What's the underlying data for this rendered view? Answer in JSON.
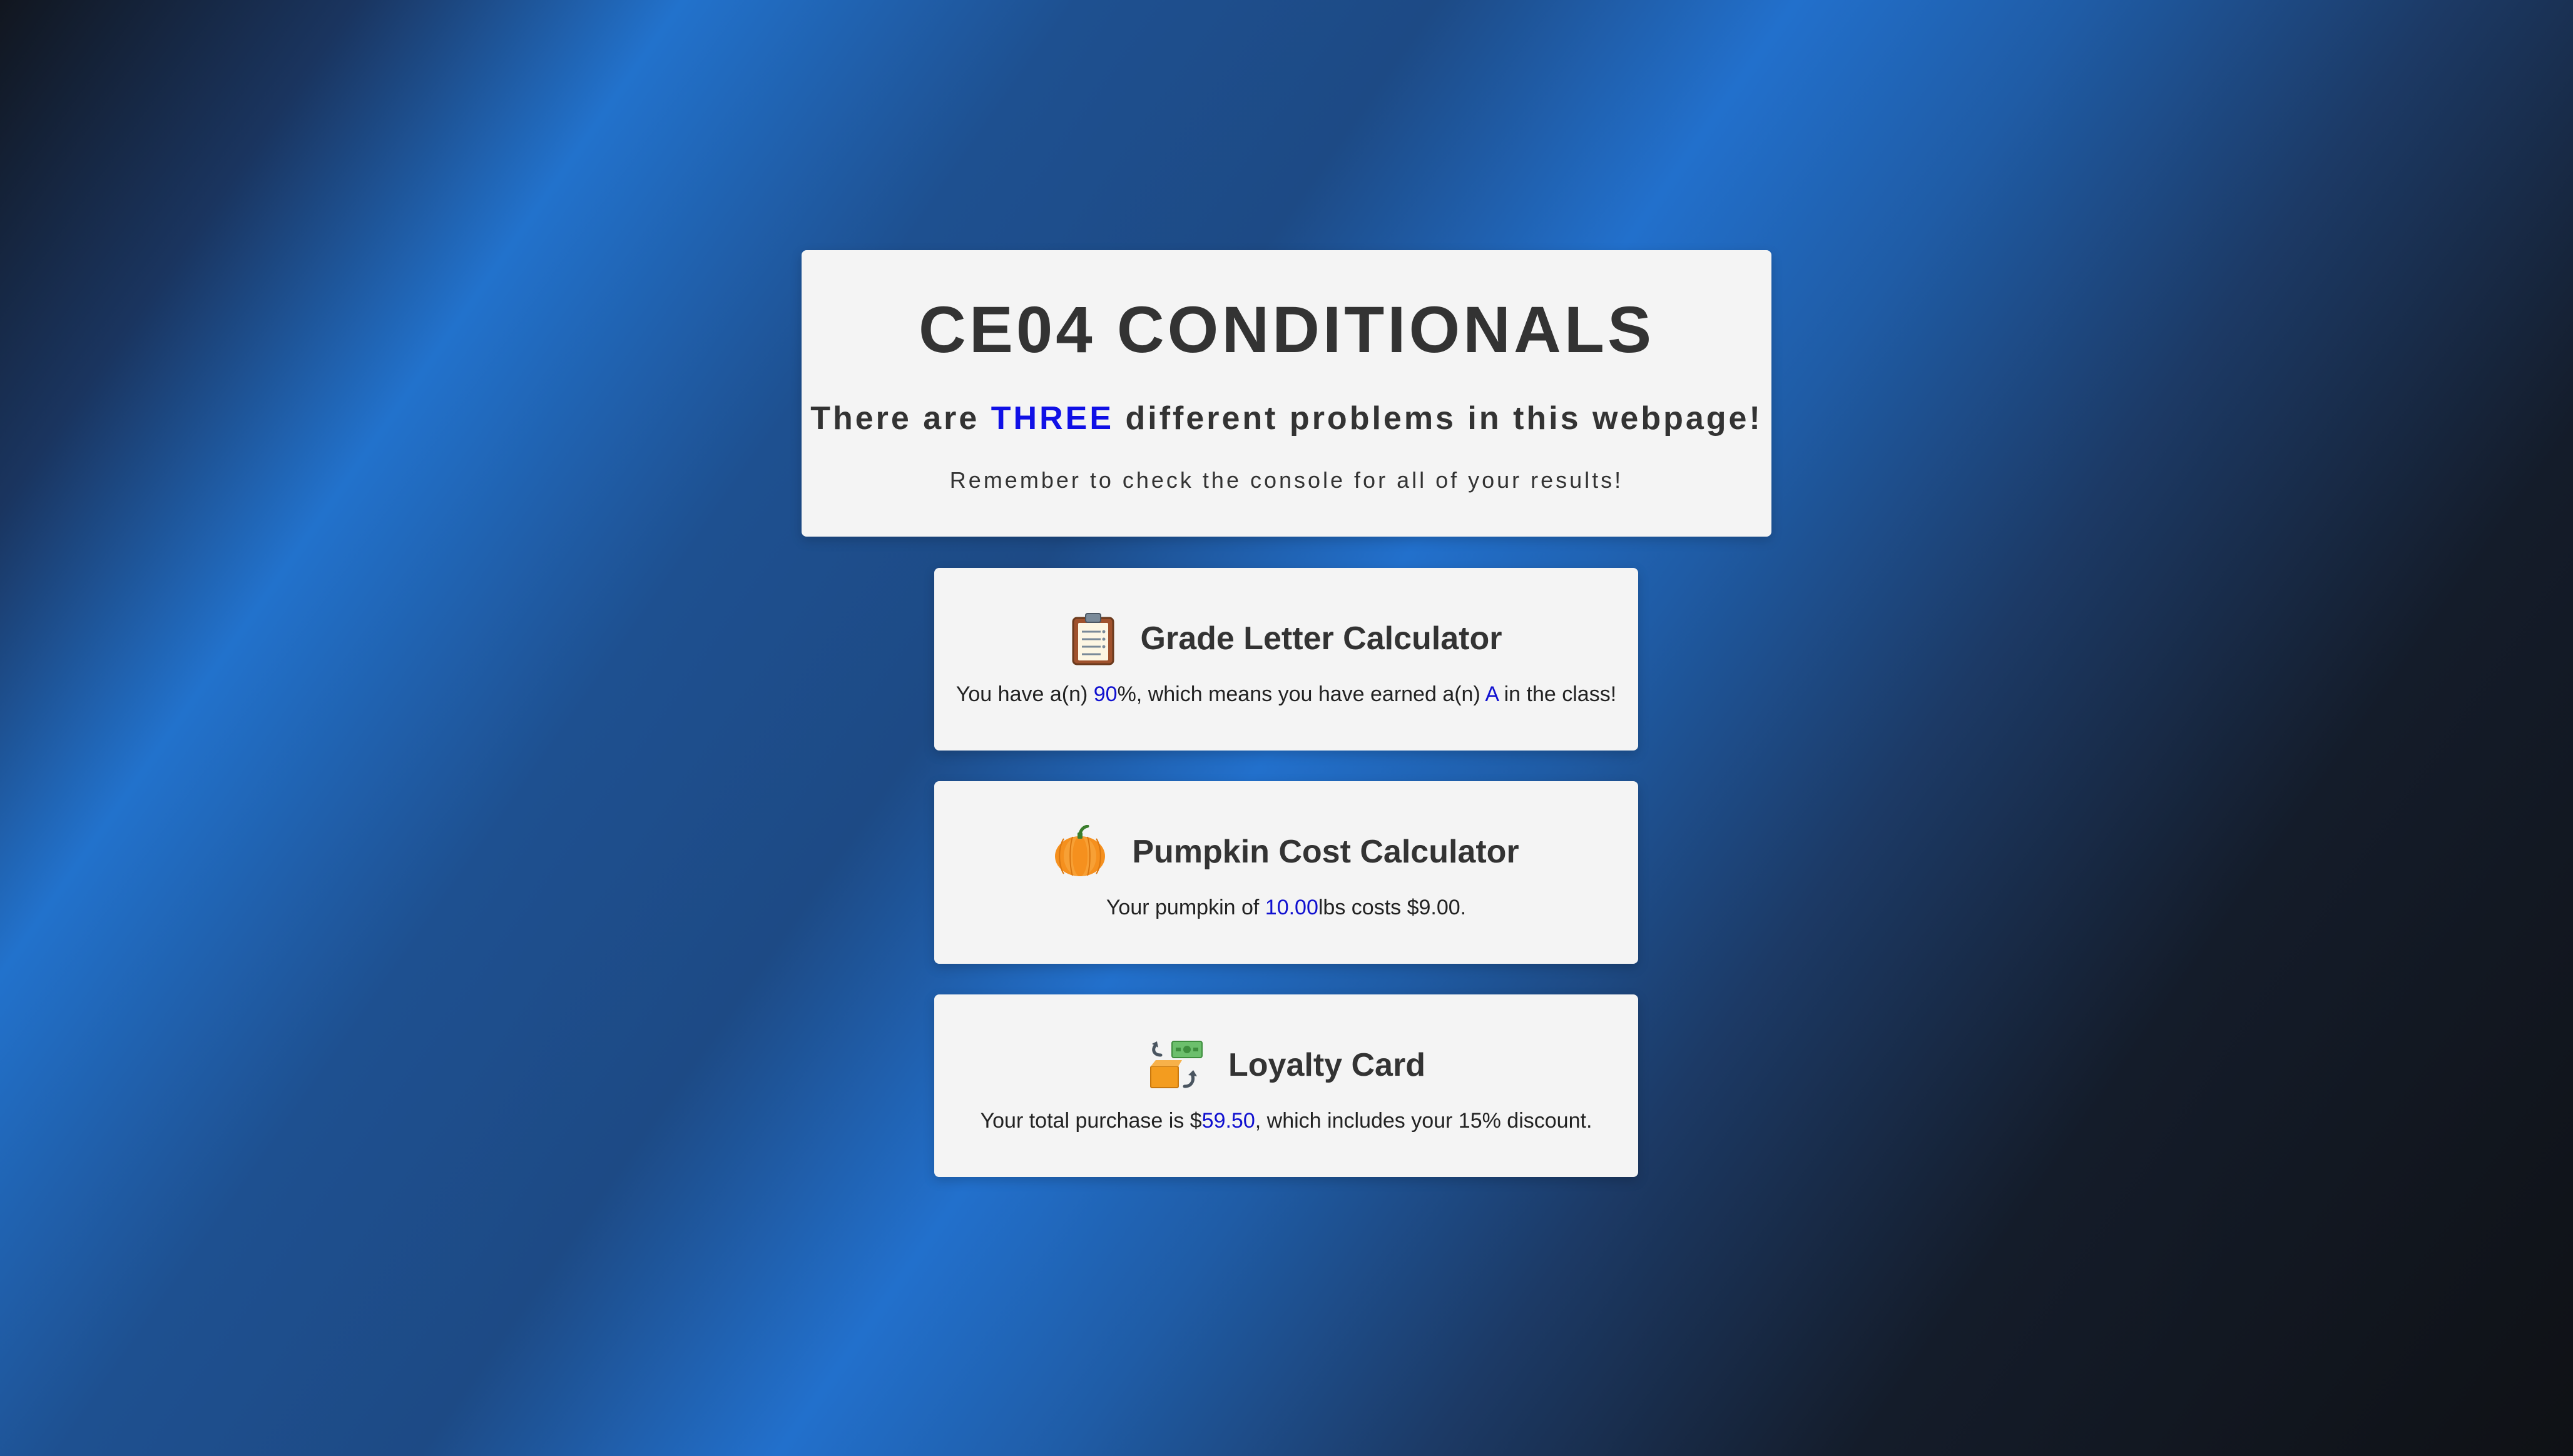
{
  "header": {
    "title": "CE04 CONDITIONALS",
    "subtitle_pre": "There are ",
    "subtitle_highlight": "THREE",
    "subtitle_post": " different problems in this webpage!",
    "note": "Remember to check the console for all of your results!"
  },
  "grade": {
    "icon": "clipboard-icon",
    "title": "Grade Letter Calculator",
    "text_1": "You have a(n) ",
    "percent": "90",
    "text_2": "%, which means you have earned a(n) ",
    "letter": "A",
    "text_3": " in the class!"
  },
  "pumpkin": {
    "icon": "pumpkin-icon",
    "title": "Pumpkin Cost Calculator",
    "text_1": "Your pumpkin of ",
    "weight": "10.00",
    "text_2": "lbs costs $9.00."
  },
  "loyalty": {
    "icon": "money-exchange-icon",
    "title": "Loyalty Card",
    "text_1": "Your total purchase is $",
    "total": "59.50",
    "text_2": ", which includes your 15% discount."
  },
  "colors": {
    "highlight": "#1010e6",
    "value": "#1010d0",
    "card_bg": "#f4f4f4",
    "text": "#333333"
  }
}
